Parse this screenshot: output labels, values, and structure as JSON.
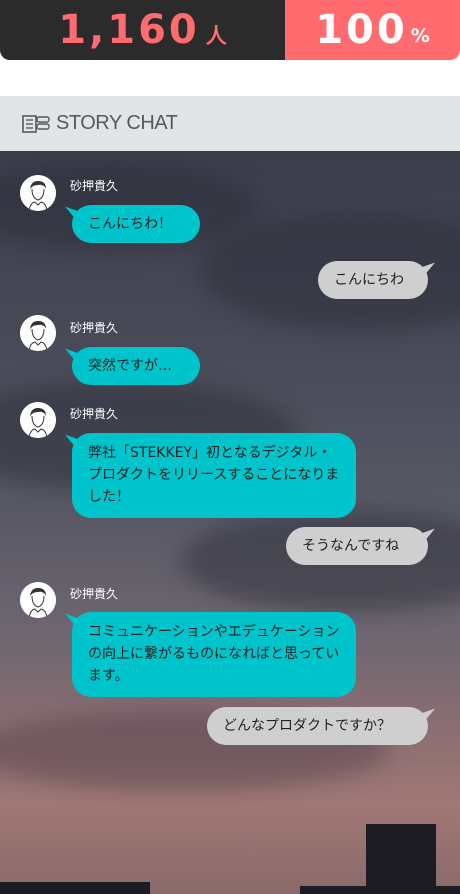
{
  "stats": {
    "count_value": "1,160",
    "count_unit": "人",
    "percent_value": "100",
    "percent_unit": "%"
  },
  "header": {
    "logo_text": "STORY CHAT"
  },
  "messages": [
    {
      "side": "in",
      "sender": "砂押貴久",
      "text": "こんにちわ！"
    },
    {
      "side": "out",
      "text": "こんにちわ"
    },
    {
      "side": "in",
      "sender": "砂押貴久",
      "text": "突然ですが…"
    },
    {
      "side": "in",
      "sender": "砂押貴久",
      "text": "弊社「STEKKEY」初となるデジタル・プロダクトをリリースすることになりました！"
    },
    {
      "side": "out",
      "text": "そうなんですね"
    },
    {
      "side": "in",
      "sender": "砂押貴久",
      "text": "コミュニケーションやエデュケーションの向上に繋がるものになればと思っています。"
    },
    {
      "side": "out",
      "text": "どんなプロダクトですか？"
    }
  ]
}
